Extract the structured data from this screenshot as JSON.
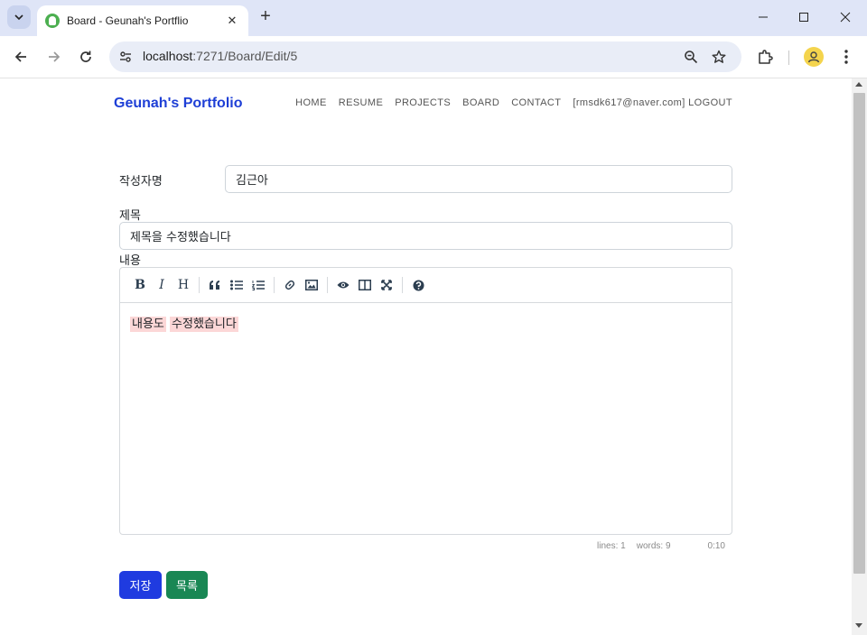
{
  "browser": {
    "tab_title": "Board - Geunah's Portflio",
    "url_host": "localhost",
    "url_path": ":7271/Board/Edit/5"
  },
  "site": {
    "brand": "Geunah's Portfolio",
    "nav": [
      "HOME",
      "RESUME",
      "PROJECTS",
      "BOARD",
      "CONTACT",
      "[rmsdk617@naver.com] LOGOUT"
    ]
  },
  "form": {
    "author_label": "작성자명",
    "author_value": "김근아",
    "title_label": "제목",
    "title_value": "제목을 수정했습니다",
    "content_label": "내용",
    "content_words": [
      "내용도",
      "수정했습니다"
    ]
  },
  "editor": {
    "toolbar_icons": [
      "bold-icon",
      "italic-icon",
      "heading-icon",
      "quote-icon",
      "unordered-list-icon",
      "ordered-list-icon",
      "link-icon",
      "image-icon",
      "preview-icon",
      "side-by-side-icon",
      "fullscreen-icon",
      "guide-icon"
    ],
    "status": {
      "lines": "lines: 1",
      "words": "words: 9",
      "cursor": "0:10"
    }
  },
  "buttons": {
    "save": "저장",
    "list": "목록"
  },
  "colors": {
    "brand": "#1e3fd6",
    "save": "#1f3be0",
    "list": "#198754",
    "highlight": "#fcd7d7"
  }
}
